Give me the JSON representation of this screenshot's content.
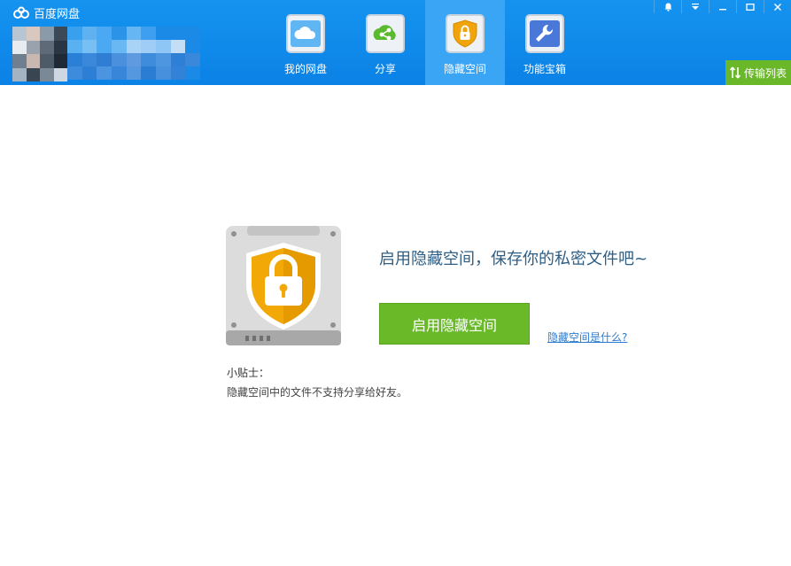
{
  "app": {
    "title": "百度网盘"
  },
  "nav": {
    "tabs": [
      {
        "label": "我的网盘",
        "icon": "cloud-icon"
      },
      {
        "label": "分享",
        "icon": "share-icon"
      },
      {
        "label": "隐藏空间",
        "icon": "shield-lock-icon",
        "active": true
      },
      {
        "label": "功能宝箱",
        "icon": "wrench-icon"
      }
    ]
  },
  "window_controls": [
    "bell-icon",
    "dropdown-icon",
    "minimize-icon",
    "maximize-icon",
    "close-icon"
  ],
  "transfer": {
    "label": "传输列表"
  },
  "main": {
    "headline": "启用隐藏空间，保存你的私密文件吧~",
    "enable_button": "启用隐藏空间",
    "what_link": "隐藏空间是什么?",
    "tip_title": "小贴士：",
    "tip_text": "隐藏空间中的文件不支持分享给好友。"
  },
  "colors": {
    "header": "#0b82e6",
    "active_tab": "#3aa4f5",
    "green": "#6ab929",
    "headline": "#2d5e86"
  }
}
